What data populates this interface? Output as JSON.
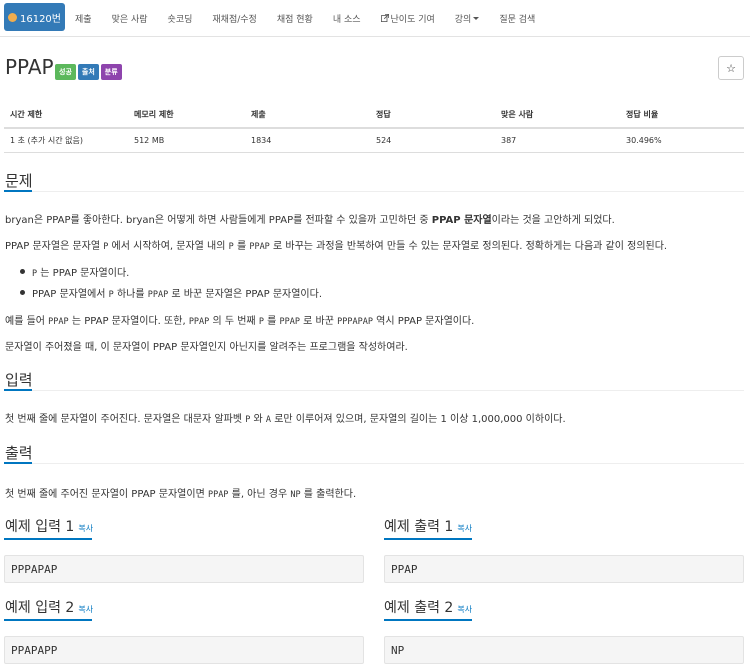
{
  "nav": {
    "problem_id": "16120번",
    "items": [
      "제출",
      "맞은 사람",
      "숏코딩",
      "재채점/수정",
      "채점 현황",
      "내 소스",
      "난이도 기여",
      "강의",
      "질문 검색"
    ]
  },
  "title": "PPAP",
  "labels": [
    {
      "text": "성공",
      "color": "#5cb85c"
    },
    {
      "text": "출처",
      "color": "#337ab7"
    },
    {
      "text": "분류",
      "color": "#8e44ad"
    }
  ],
  "star": "☆",
  "stats": {
    "headers": [
      "시간 제한",
      "메모리 제한",
      "제출",
      "정답",
      "맞은 사람",
      "정답 비율"
    ],
    "values": [
      "1 초 (추가 시간 없음)",
      "512 MB",
      "1834",
      "524",
      "387",
      "30.496%"
    ]
  },
  "sections": {
    "problem": "문제",
    "input": "입력",
    "output": "출력"
  },
  "problem": {
    "p1_a": "bryan은 PPAP를 좋아한다. bryan은 어떻게 하면 사람들에게 PPAP를 전파할 수 있을까 고민하던 중 ",
    "p1_b": "PPAP 문자열",
    "p1_c": "이라는 것을 고안하게 되었다.",
    "p2_a": "PPAP 문자열은 문자열 ",
    "p2_code1": "P",
    "p2_b": " 에서 시작하여, 문자열 내의 ",
    "p2_code2": "P",
    "p2_c": " 를 ",
    "p2_code3": "PPAP",
    "p2_d": " 로 바꾸는 과정을 반복하여 만들 수 있는 문자열로 정의된다. 정확하게는 다음과 같이 정의된다.",
    "b1_code": "P",
    "b1_text": " 는 PPAP 문자열이다.",
    "b2_a": "PPAP 문자열에서 ",
    "b2_code1": "P",
    "b2_b": " 하나를 ",
    "b2_code2": "PPAP",
    "b2_c": " 로 바꾼 문자열은 PPAP 문자열이다.",
    "p3_a": "예를 들어 ",
    "p3_code1": "PPAP",
    "p3_b": " 는 PPAP 문자열이다. 또한, ",
    "p3_code2": "PPAP",
    "p3_c": " 의 두 번째 ",
    "p3_code3": "P",
    "p3_d": " 를 ",
    "p3_code4": "PPAP",
    "p3_e": " 로 바꾼 ",
    "p3_code5": "PPPAPAP",
    "p3_f": " 역시 PPAP 문자열이다.",
    "p4": "문자열이 주어졌을 때, 이 문자열이 PPAP 문자열인지 아닌지를 알려주는 프로그램을 작성하여라."
  },
  "input": {
    "a": "첫 번째 줄에 문자열이 주어진다. 문자열은 대문자 알파벳 ",
    "code1": "P",
    "b": " 와 ",
    "code2": "A",
    "c": " 로만 이루어져 있으며, 문자열의 길이는 1 이상 1,000,000 이하이다."
  },
  "output": {
    "a": "첫 번째 줄에 주어진 문자열이 PPAP 문자열이면 ",
    "code1": "PPAP",
    "b": " 를, 아닌 경우 ",
    "code2": "NP",
    "c": " 를 출력한다."
  },
  "samples": {
    "copy": "복사",
    "in1_title": "예제 입력 1",
    "out1_title": "예제 출력 1",
    "in2_title": "예제 입력 2",
    "out2_title": "예제 출력 2",
    "in1": "PPPAPAP",
    "out1": "PPAP",
    "in2": "PPAPAPP",
    "out2": "NP"
  }
}
